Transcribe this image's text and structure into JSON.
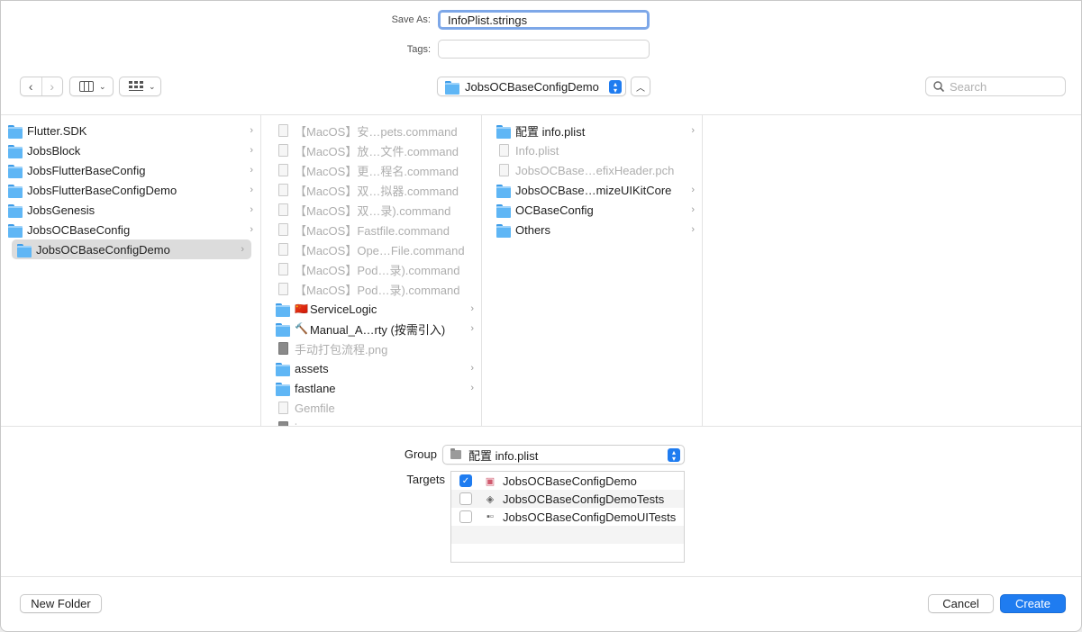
{
  "save_as": {
    "label": "Save As:",
    "value": "InfoPlist.strings"
  },
  "tags": {
    "label": "Tags:",
    "value": ""
  },
  "toolbar": {
    "current_folder": "JobsOCBaseConfigDemo",
    "search_placeholder": "Search"
  },
  "columns": [
    {
      "items": [
        {
          "name": "Flutter.SDK",
          "type": "folder",
          "has_children": true
        },
        {
          "name": "JobsBlock",
          "type": "folder",
          "has_children": true
        },
        {
          "name": "JobsFlutterBaseConfig",
          "type": "folder",
          "has_children": true
        },
        {
          "name": "JobsFlutterBaseConfigDemo",
          "type": "folder",
          "has_children": true
        },
        {
          "name": "JobsGenesis",
          "type": "folder",
          "has_children": true
        },
        {
          "name": "JobsOCBaseConfig",
          "type": "folder",
          "has_children": true
        },
        {
          "name": "JobsOCBaseConfigDemo",
          "type": "folder",
          "has_children": true,
          "selected": true
        }
      ]
    },
    {
      "items": [
        {
          "name": "【MacOS】安…pets.command",
          "type": "file",
          "dim": true
        },
        {
          "name": "【MacOS】放…文件.command",
          "type": "file",
          "dim": true
        },
        {
          "name": "【MacOS】更…程名.command",
          "type": "file",
          "dim": true
        },
        {
          "name": "【MacOS】双…拟器.command",
          "type": "file",
          "dim": true
        },
        {
          "name": "【MacOS】双…录).command",
          "type": "file",
          "dim": true
        },
        {
          "name": "【MacOS】Fastfile.command",
          "type": "file",
          "dim": true
        },
        {
          "name": "【MacOS】Ope…File.command",
          "type": "file",
          "dim": true
        },
        {
          "name": "【MacOS】Pod…录).command",
          "type": "file",
          "dim": true
        },
        {
          "name": "【MacOS】Pod…录).command",
          "type": "file",
          "dim": true
        },
        {
          "name": "ServiceLogic",
          "type": "folder",
          "has_children": true,
          "emoji": "🇨🇳"
        },
        {
          "name": "Manual_A…rty (按需引入)",
          "type": "folder",
          "has_children": true,
          "emoji": "🔨"
        },
        {
          "name": "手动打包流程.png",
          "type": "image",
          "dim": true
        },
        {
          "name": "assets",
          "type": "folder",
          "has_children": true
        },
        {
          "name": "fastlane",
          "type": "folder",
          "has_children": true
        },
        {
          "name": "Gemfile",
          "type": "file",
          "dim": true
        },
        {
          "name": "icon.png",
          "type": "image",
          "dim": true
        }
      ]
    },
    {
      "items": [
        {
          "name": "配置 info.plist",
          "type": "folder",
          "has_children": true
        },
        {
          "name": "Info.plist",
          "type": "file",
          "dim": true
        },
        {
          "name": "JobsOCBase…efixHeader.pch",
          "type": "file",
          "dim": true
        },
        {
          "name": "JobsOCBase…mizeUIKitCore",
          "type": "folder",
          "has_children": true
        },
        {
          "name": "OCBaseConfig",
          "type": "folder",
          "has_children": true
        },
        {
          "name": "Others",
          "type": "folder",
          "has_children": true
        }
      ]
    }
  ],
  "options": {
    "group_label": "Group",
    "group_value": "配置 info.plist",
    "targets_label": "Targets",
    "targets": [
      {
        "name": "JobsOCBaseConfigDemo",
        "checked": true,
        "icon": "app-icon"
      },
      {
        "name": "JobsOCBaseConfigDemoTests",
        "checked": false,
        "icon": "test-bundle-icon"
      },
      {
        "name": "JobsOCBaseConfigDemoUITests",
        "checked": false,
        "icon": "ui-test-bundle-icon"
      }
    ]
  },
  "buttons": {
    "new_folder": "New Folder",
    "cancel": "Cancel",
    "create": "Create"
  },
  "colors": {
    "accent": "#1f7cf0",
    "folder": "#5fb6f5"
  }
}
